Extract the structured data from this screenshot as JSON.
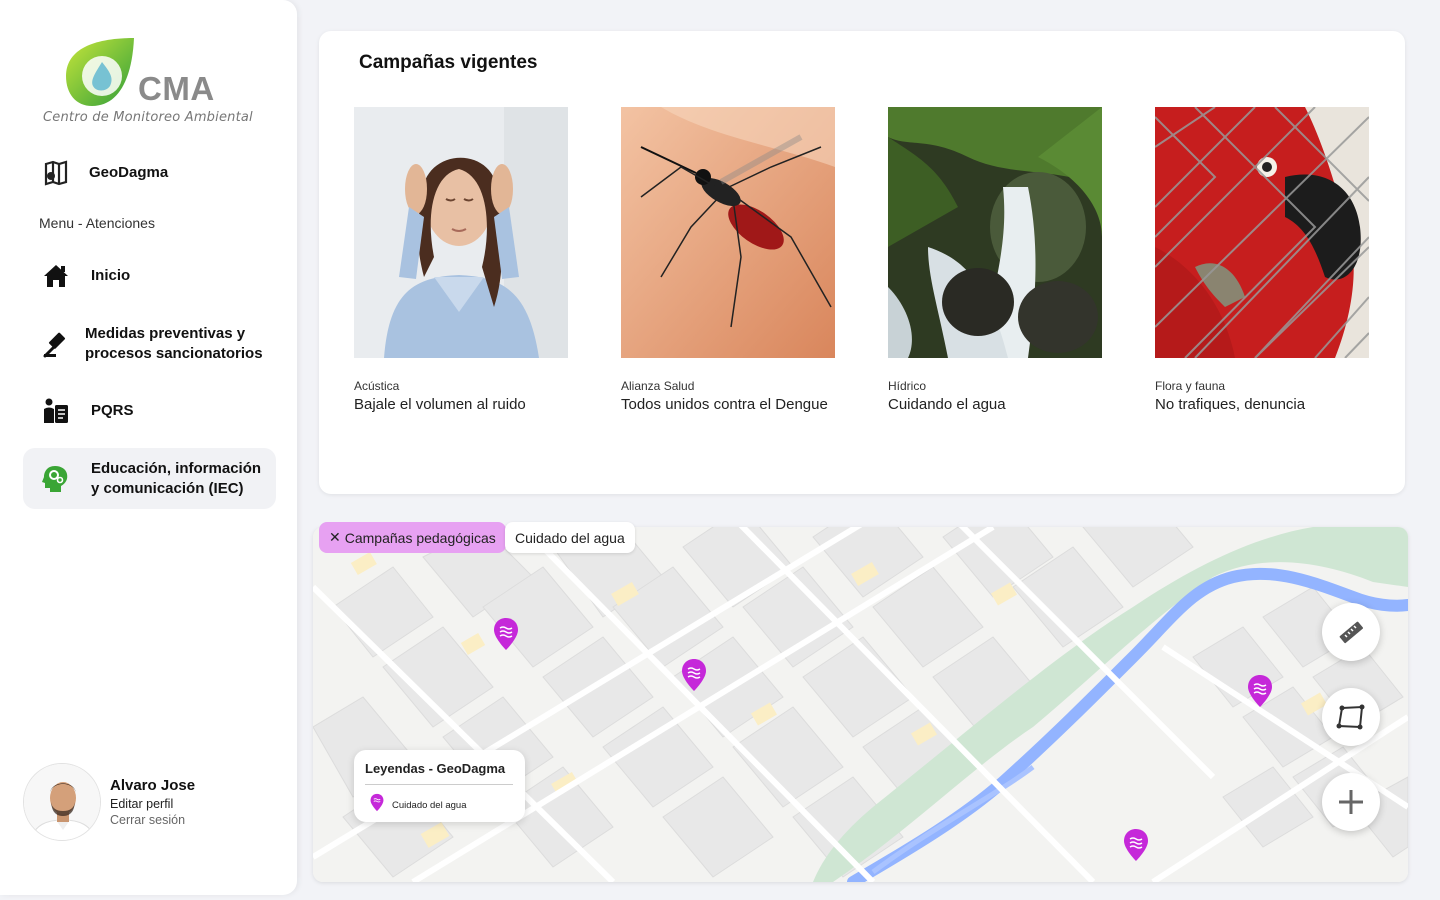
{
  "brand": {
    "name": "CMA",
    "subtitle": "Centro de Monitoreo Ambiental"
  },
  "sidebar": {
    "geodagma_label": "GeoDagma",
    "section_label": "Menu - Atenciones",
    "items": [
      {
        "label": "Inicio",
        "icon": "home-icon"
      },
      {
        "label": "Medidas preventivas y procesos sancionatorios",
        "icon": "gavel-icon"
      },
      {
        "label": "PQRS",
        "icon": "pqrs-icon"
      },
      {
        "label": "Educación, información y comunicación (IEC)",
        "icon": "head-gears-icon",
        "active": true
      }
    ]
  },
  "profile": {
    "name": "Alvaro Jose",
    "edit_label": "Editar perfil",
    "logout_label": "Cerrar sesión"
  },
  "campaigns": {
    "title": "Campañas vigentes",
    "items": [
      {
        "category": "Acústica",
        "title": "Bajale el volumen al ruido"
      },
      {
        "category": "Alianza Salud",
        "title": "Todos unidos contra el Dengue"
      },
      {
        "category": "Hídrico",
        "title": "Cuidando el agua"
      },
      {
        "category": "Flora y fauna",
        "title": "No trafiques, denuncia"
      }
    ]
  },
  "map": {
    "filters": [
      {
        "label": "Campañas pedagógicas",
        "active": true
      },
      {
        "label": "Cuidado del agua",
        "active": false
      }
    ],
    "legend": {
      "title": "Leyendas - GeoDagma",
      "items": [
        {
          "label": "Cuidado del agua",
          "icon": "water-pin-icon"
        }
      ]
    },
    "tools": [
      "ruler-icon",
      "polygon-icon",
      "plus-icon"
    ]
  },
  "colors": {
    "accent_pink": "#e7a1f2",
    "marker": "#c528d9",
    "green": "#3aa535",
    "river": "#93b4ff",
    "park": "#cfe6d3"
  }
}
